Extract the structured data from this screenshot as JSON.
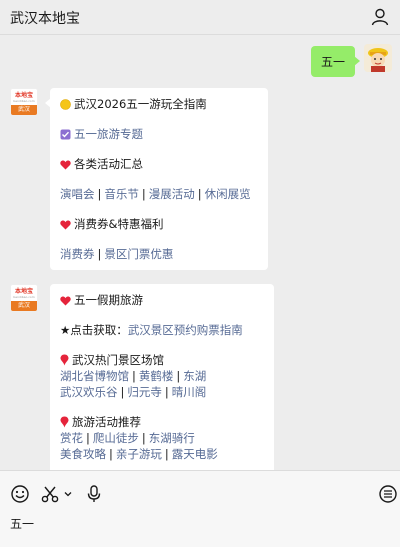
{
  "header": {
    "title": "武汉本地宝"
  },
  "user_message": {
    "text": "五一"
  },
  "bot_avatar": {
    "brand": "本地宝",
    "site": "bendibao.com",
    "city": "武汉"
  },
  "card1": {
    "heading": "武汉2026五一游玩全指南",
    "topic": "五一旅游专题",
    "activities_title": "各类活动汇总",
    "activities_links": [
      "演唱会",
      "音乐节",
      "漫展活动",
      "休闲展览"
    ],
    "discount_title": "消费券&特惠福利",
    "discount_links": [
      "消费券",
      "景区门票优惠"
    ]
  },
  "card2": {
    "heading": "五一假期旅游",
    "click_prefix": "★点击获取：",
    "click_link": "武汉景区预约购票指南",
    "venues_title": "武汉热门景区场馆",
    "venues_row1": [
      "湖北省博物馆",
      "黄鹤楼",
      "东湖"
    ],
    "venues_row2": [
      "武汉欢乐谷",
      "归元寺",
      "晴川阁"
    ],
    "travel_title": "旅游活动推荐",
    "travel_row1": [
      "赏花",
      "爬山徒步",
      "东湖骑行"
    ],
    "travel_row2": [
      "美食攻略",
      "亲子游玩",
      "露天电影"
    ]
  },
  "input": {
    "text": "五一"
  },
  "colors": {
    "bubble_green": "#95ec69",
    "link": "#576b95",
    "heart": "#e5243b",
    "badge_orange": "#e97a22"
  },
  "icons": [
    "user-icon",
    "emoji-icon",
    "scissors-icon",
    "chevron-down-icon",
    "microphone-icon",
    "menu-icon",
    "heart-icon",
    "checkbox-icon",
    "yellow-circle-icon",
    "pin-icon"
  ]
}
